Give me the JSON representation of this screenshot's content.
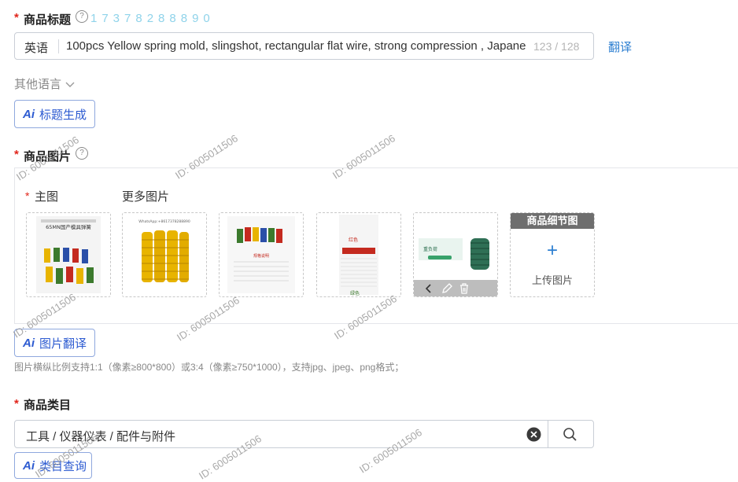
{
  "title_field": {
    "label": "商品标题",
    "help": "?",
    "phone_overlay": "17378288890",
    "language": "英语",
    "value": "100pcs Yellow spring mold, slingshot, rectangular flat wire, strong compression , Japane",
    "counter": "123 / 128",
    "translate_label": "翻译"
  },
  "other_languages": {
    "label": "其他语言",
    "icon": "chevron-down-icon"
  },
  "ai_title_button": {
    "ai": "Ai",
    "label": "标题生成"
  },
  "images_field": {
    "label": "商品图片",
    "help": "?",
    "main_label": "主图",
    "more_label": "更多图片",
    "thumb1": {
      "line1": "65MN国产模具弹簧"
    },
    "thumb2": {
      "line1": "WhatsApp:+8617378288890"
    },
    "thumb3": {
      "line1": "规格说明"
    },
    "thumb4": {
      "line1": "红色",
      "line2": "绿色"
    },
    "thumb5": {
      "badge": "重负荷"
    },
    "detail_header": "商品细节图",
    "upload_plus": "+",
    "upload_label": "上传图片"
  },
  "ai_image_button": {
    "ai": "Ai",
    "label": "图片翻译"
  },
  "image_hint": "图片横纵比例支持1:1（像素≥800*800）或3:4（像素≥750*1000），支持jpg、jpeg、png格式；",
  "category_field": {
    "label": "商品类目",
    "value": "工具 / 仪器仪表 / 配件与附件",
    "clear_icon": "clear-circle-icon",
    "search_icon": "search-icon"
  },
  "ai_category_button": {
    "ai": "Ai",
    "label": "类目查询"
  },
  "watermark": "ID: 6005011506",
  "colors": {
    "required": "#e1251b",
    "accent": "#2d5bd1",
    "link": "#2d7fd1",
    "spring_yellow": "#e8b400"
  }
}
